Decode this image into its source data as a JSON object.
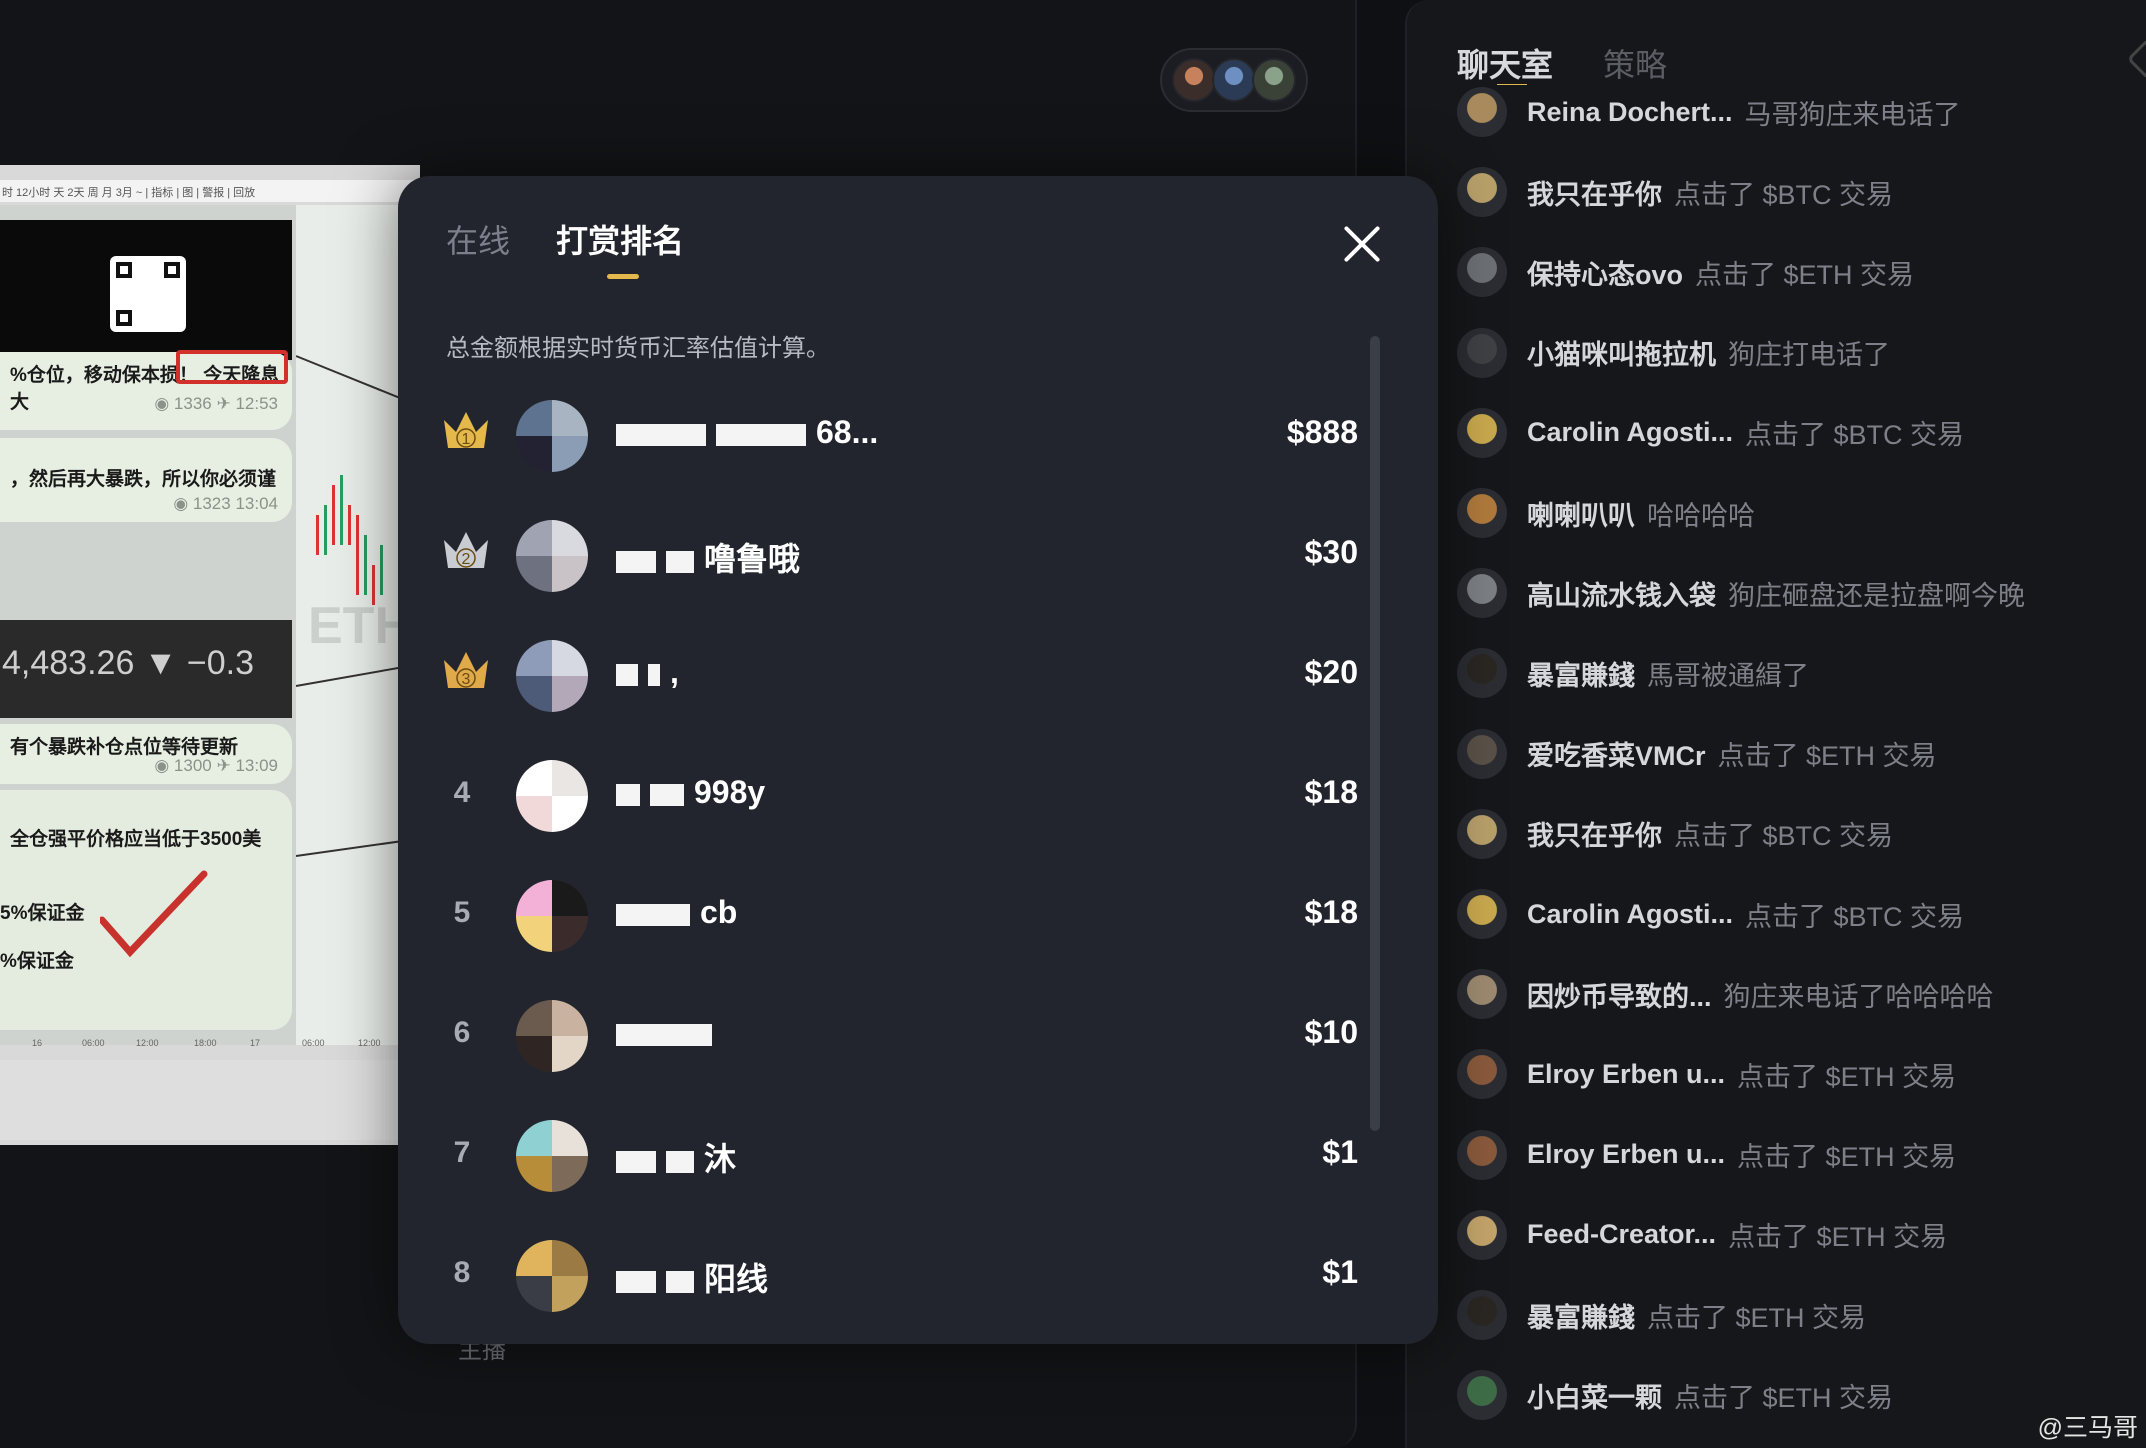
{
  "stream": {
    "toolbar": "时 12小时 天 2天 周 月 3月 ~ | 指标 | 图 | 警报 | 回放",
    "msg1": "%仓位，移动保本损！",
    "msg1_highlight": "今天降息大",
    "msg1_views": "1336",
    "msg1_time": "12:53",
    "msg2": "，然后再大暴跌，所以你必须谨",
    "msg2_views": "1323",
    "msg2_time": "13:04",
    "price": "4,483.26 ▼ −0.3",
    "msg3": "有个暴跌补仓点位等待更新",
    "msg3_views": "1300",
    "msg3_time": "13:09",
    "msg4_line1": "全仓强平价格应当低于3500美",
    "msg4_line2": "5%保证金",
    "msg4_line3": "%保证金",
    "axis_labels": [
      "16",
      "06:00",
      "12:00",
      "18:00",
      "17",
      "06:00",
      "12:00"
    ],
    "watermark_text": "ETH"
  },
  "behind_modal_label": "主播",
  "modal": {
    "tabs": {
      "online": "在线",
      "ranking": "打赏排名"
    },
    "note": "总金额根据实时货币汇率估值计算。",
    "ranks": [
      {
        "rank": "1",
        "crown": "gold",
        "name_visible": "68...",
        "amount": "$888",
        "avatar_colors": [
          "#5d7390",
          "#a9b4c3",
          "#223",
          "#8b9db4"
        ]
      },
      {
        "rank": "2",
        "crown": "silver",
        "name_visible": "噜鲁哦",
        "amount": "$30",
        "avatar_colors": [
          "#9fa3b2",
          "#d9dae0",
          "#6e7180",
          "#c9c3c8"
        ]
      },
      {
        "rank": "3",
        "crown": "bronze",
        "name_visible": ",",
        "amount": "$20",
        "avatar_colors": [
          "#8e9cb9",
          "#d7d9e2",
          "#4d5a78",
          "#b2a8b8"
        ]
      },
      {
        "rank": "4",
        "crown": "",
        "name_visible": "998y",
        "amount": "$18",
        "avatar_colors": [
          "#ffffff",
          "#e9e6e4",
          "#f2d9d9",
          "#ffffff"
        ]
      },
      {
        "rank": "5",
        "crown": "",
        "name_visible": "cb",
        "amount": "$18",
        "avatar_colors": [
          "#f4b1d8",
          "#1b1a1a",
          "#f2d27a",
          "#3b2b2b"
        ]
      },
      {
        "rank": "6",
        "crown": "",
        "name_visible": "",
        "amount": "$10",
        "avatar_colors": [
          "#6b5a4e",
          "#c9b3a0",
          "#2f2624",
          "#e4d6c6"
        ]
      },
      {
        "rank": "7",
        "crown": "",
        "name_visible": "沐",
        "amount": "$1",
        "avatar_colors": [
          "#8fd1d3",
          "#e7e1da",
          "#b88d3a",
          "#7e6a58"
        ]
      },
      {
        "rank": "8",
        "crown": "",
        "name_visible": "阳线",
        "amount": "$1",
        "avatar_colors": [
          "#e0b45d",
          "#9b7a44",
          "#3a3d46",
          "#c2a15c"
        ]
      }
    ],
    "crown_colors": {
      "gold": "#e5b84b",
      "silver": "#c9ccd3",
      "bronze": "#e0a94a"
    }
  },
  "chat": {
    "tabs": {
      "room": "聊天室",
      "strategy": "策略"
    },
    "messages": [
      {
        "name": "Reina Dochert...",
        "text": "马哥狗庄来电话了",
        "avatar": "#a88a5c"
      },
      {
        "name": "我只在乎你",
        "text": "点击了 $BTC 交易",
        "avatar": "#b8a06a"
      },
      {
        "name": "保持心态ovo",
        "text": "点击了 $ETH 交易",
        "avatar": "#6d7075"
      },
      {
        "name": "小猫咪叫拖拉机",
        "text": "狗庄打电话了",
        "avatar": "#3f4145"
      },
      {
        "name": "Carolin Agosti...",
        "text": "点击了 $BTC 交易",
        "avatar": "#c9a94e"
      },
      {
        "name": "喇喇叭叭",
        "text": "哈哈哈哈",
        "avatar": "#b07a3c"
      },
      {
        "name": "高山流水钱入袋",
        "text": "狗庄砸盘还是拉盘啊今晚",
        "avatar": "#7c7f84"
      },
      {
        "name": "暴富賺錢",
        "text": "馬哥被通緝了",
        "avatar": "#2a2622"
      },
      {
        "name": "爱吃香菜VMCr",
        "text": "点击了 $ETH 交易",
        "avatar": "#5a5148"
      },
      {
        "name": "我只在乎你",
        "text": "点击了 $BTC 交易",
        "avatar": "#b8a06a"
      },
      {
        "name": "Carolin Agosti...",
        "text": "点击了 $BTC 交易",
        "avatar": "#c9a94e"
      },
      {
        "name": "因炒币导致的...",
        "text": "狗庄来电话了哈哈哈哈",
        "avatar": "#9d8a70"
      },
      {
        "name": "Elroy Erben u...",
        "text": "点击了 $ETH 交易",
        "avatar": "#8a5a3c"
      },
      {
        "name": "Elroy Erben u...",
        "text": "点击了 $ETH 交易",
        "avatar": "#8a5a3c"
      },
      {
        "name": "Feed-Creator...",
        "text": "点击了 $ETH 交易",
        "avatar": "#c4a46a"
      },
      {
        "name": "暴富賺錢",
        "text": "点击了 $ETH 交易",
        "avatar": "#2a2622"
      },
      {
        "name": "小白菜一颗",
        "text": "点击了 $ETH 交易",
        "avatar": "#3d6b45"
      }
    ]
  },
  "watermark": "@三马哥"
}
